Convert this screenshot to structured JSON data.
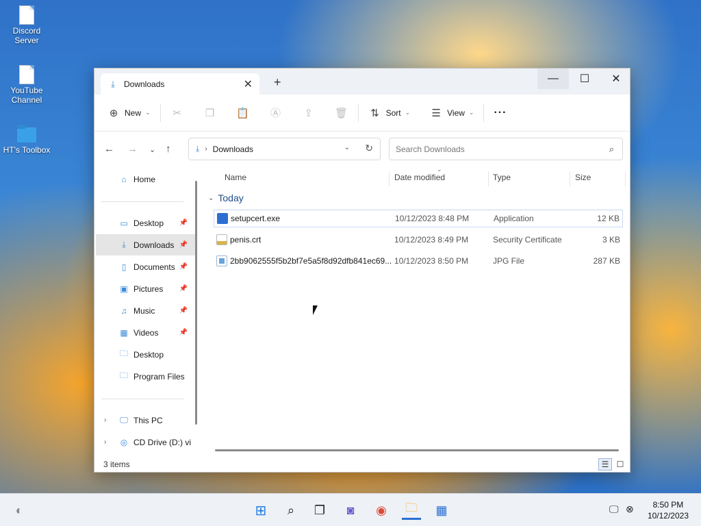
{
  "desktop": {
    "icons": [
      {
        "label": "Discord\nServer",
        "kind": "doc"
      },
      {
        "label": "YouTube\nChannel",
        "kind": "doc"
      },
      {
        "label": "HT's Toolbox",
        "kind": "folder"
      }
    ]
  },
  "window": {
    "tab_title": "Downloads",
    "tab_close": "✕",
    "new_tab": "+",
    "controls": {
      "minimize": "—",
      "maximize": "☐",
      "close": "✕"
    }
  },
  "toolbar": {
    "new_label": "New",
    "sort_label": "Sort",
    "view_label": "View",
    "more_label": "···",
    "icons": [
      "cut-icon",
      "copy-icon",
      "paste-icon",
      "rename-icon",
      "share-icon",
      "delete-icon"
    ]
  },
  "address": {
    "path": "Downloads",
    "search_placeholder": "Search Downloads"
  },
  "sidebar": {
    "home": "Home",
    "quick": [
      {
        "label": "Desktop",
        "pinned": true,
        "icon": "desktop-icon"
      },
      {
        "label": "Downloads",
        "pinned": true,
        "icon": "download-icon",
        "active": true
      },
      {
        "label": "Documents",
        "pinned": true,
        "icon": "document-icon"
      },
      {
        "label": "Pictures",
        "pinned": true,
        "icon": "picture-icon"
      },
      {
        "label": "Music",
        "pinned": true,
        "icon": "music-icon"
      },
      {
        "label": "Videos",
        "pinned": true,
        "icon": "video-icon"
      },
      {
        "label": "Desktop",
        "pinned": false,
        "icon": "folder-icon"
      },
      {
        "label": "Program Files",
        "pinned": false,
        "icon": "folder-icon"
      }
    ],
    "this_pc": "This PC",
    "cd_drive": "CD Drive (D:) vir"
  },
  "columns": {
    "name": "Name",
    "date": "Date modified",
    "type": "Type",
    "size": "Size"
  },
  "group_label": "Today",
  "files": [
    {
      "name": "setupcert.exe",
      "date": "10/12/2023 8:48 PM",
      "type": "Application",
      "size": "12 KB",
      "color": "#2d6fd1"
    },
    {
      "name": "penis.crt",
      "date": "10/12/2023 8:49 PM",
      "type": "Security Certificate",
      "size": "3 KB",
      "color": "#d8b44a"
    },
    {
      "name": "2bb9062555f5b2bf7e5a5f8d92dfb841ec69...",
      "date": "10/12/2023 8:50 PM",
      "type": "JPG File",
      "size": "287 KB",
      "color": "#6aa4d8"
    }
  ],
  "status": {
    "items": "3 items"
  },
  "taskbar": {
    "time": "8:50 PM",
    "date": "10/12/2023"
  }
}
